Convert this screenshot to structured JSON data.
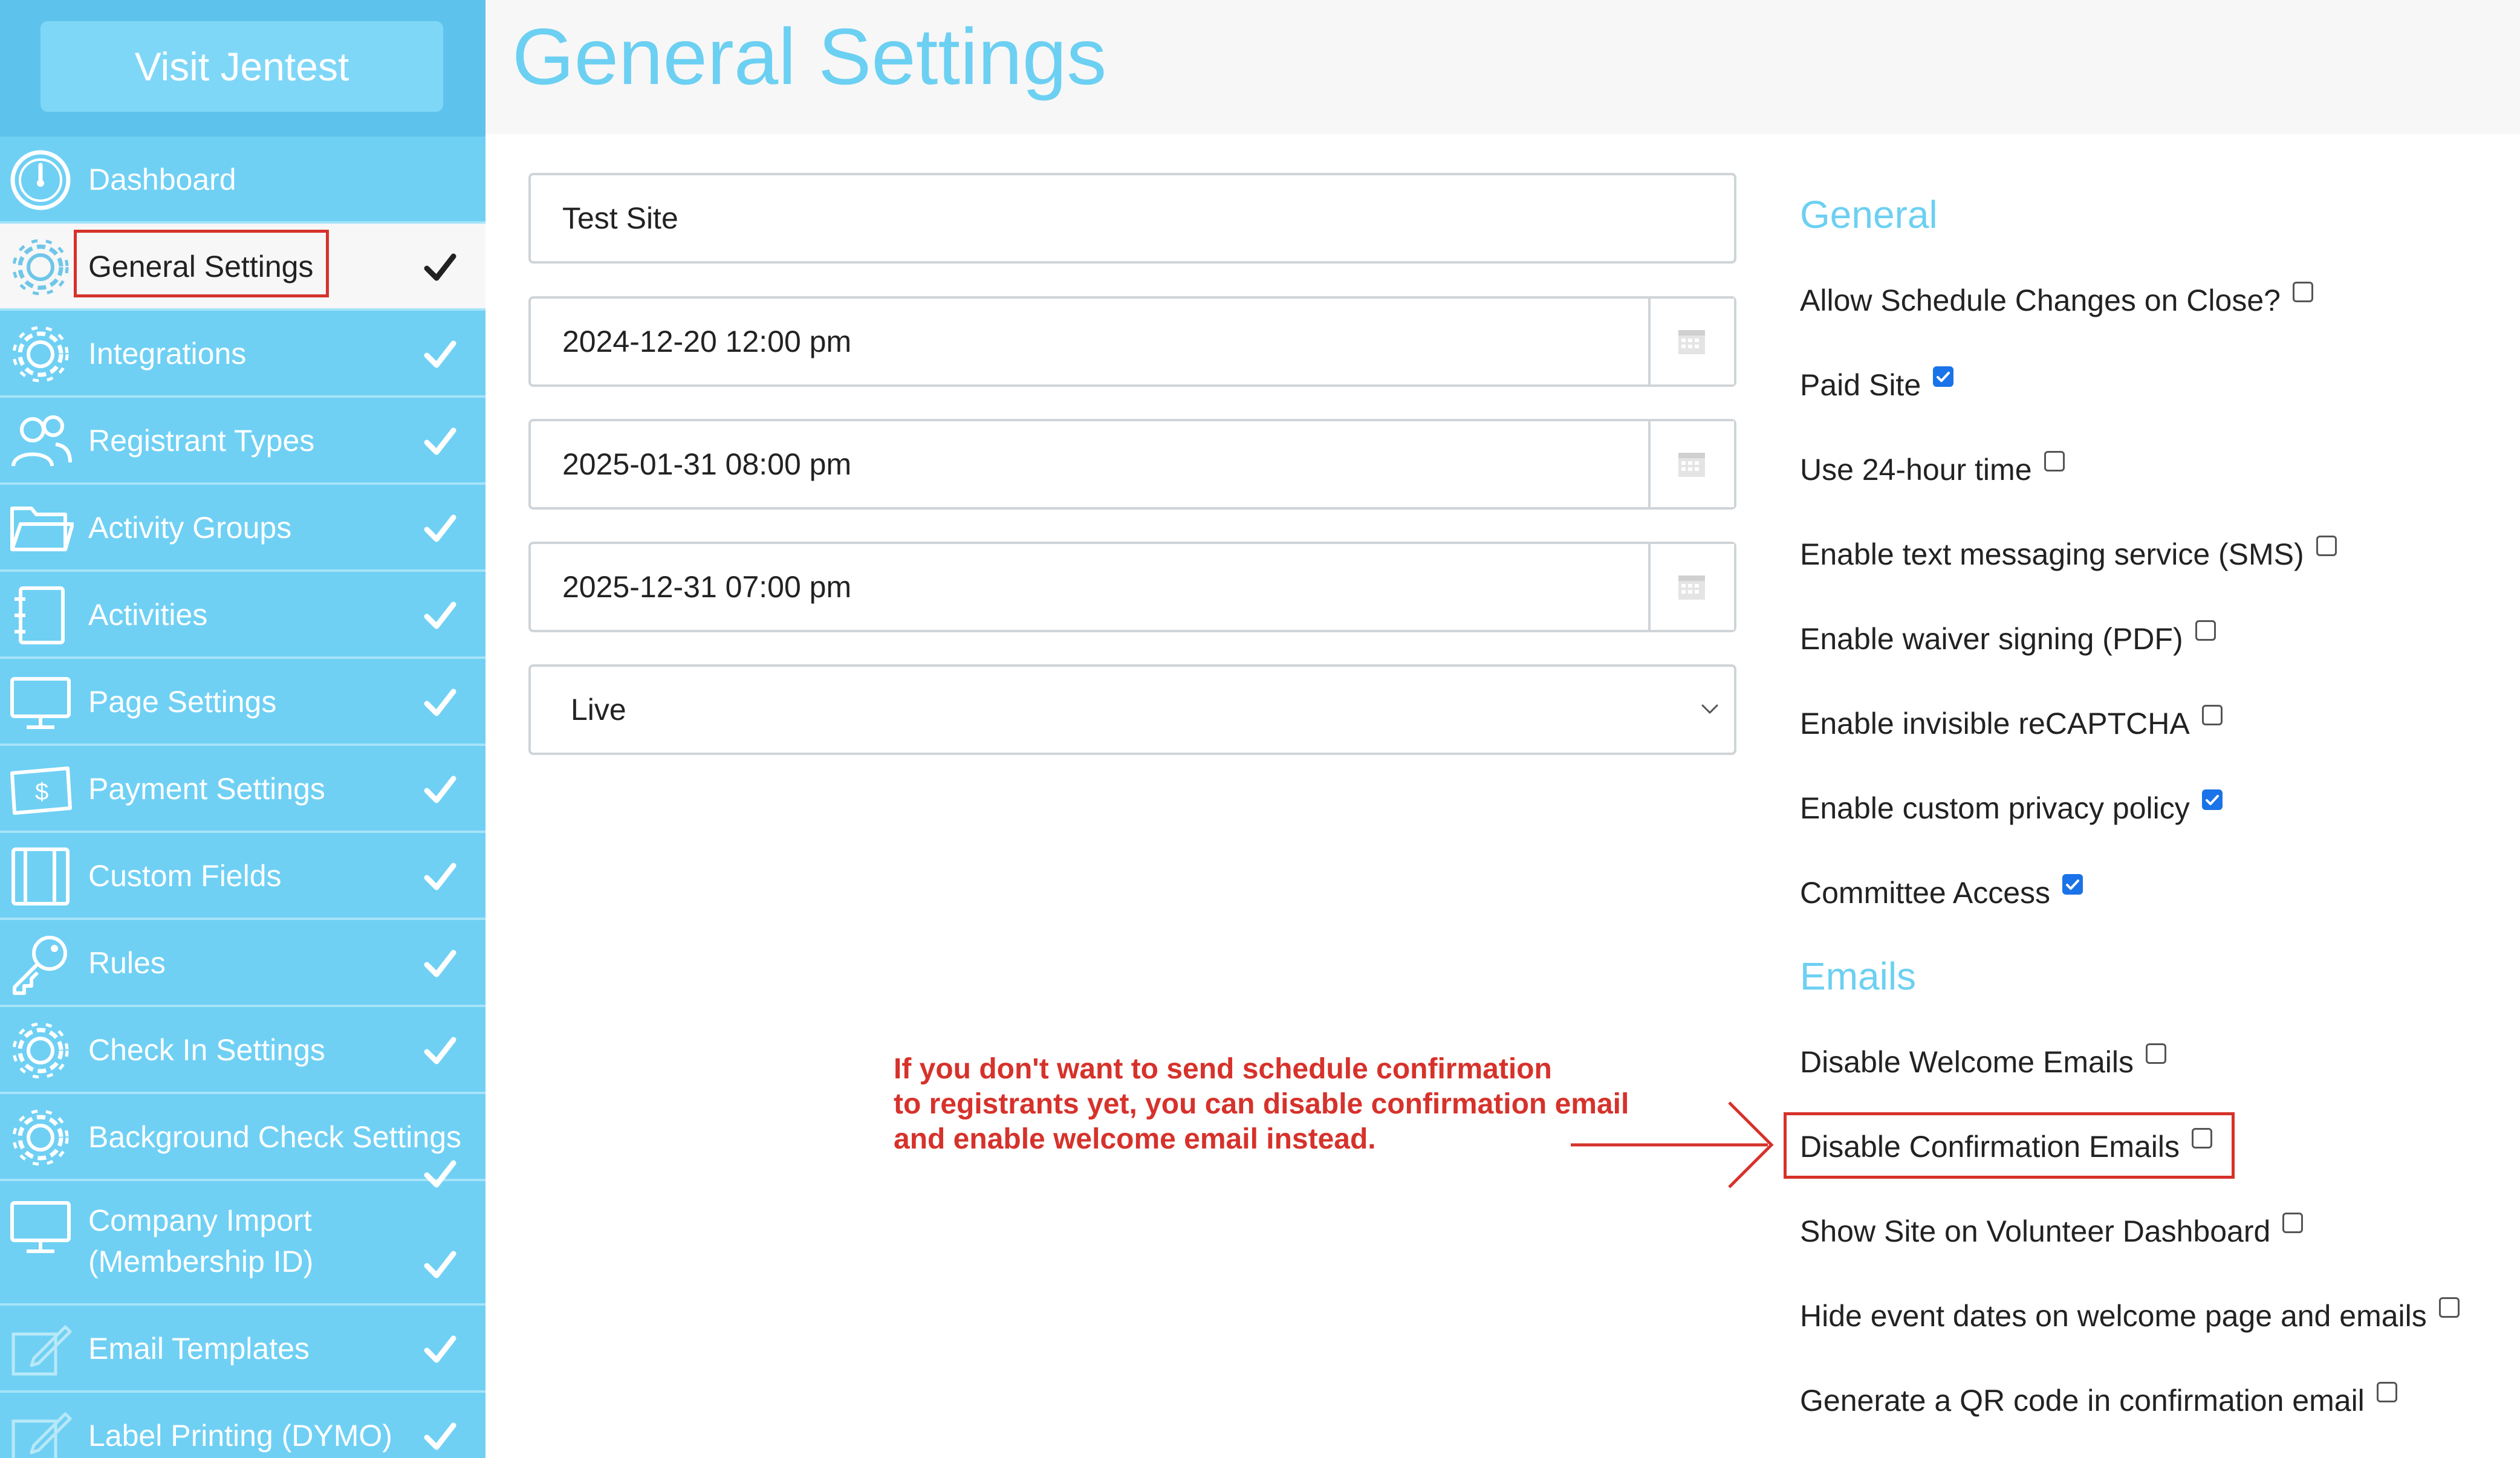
{
  "sidebar": {
    "visit_button": "Visit Jentest",
    "items": [
      {
        "label": "Dashboard",
        "icon": "dashboard-icon",
        "checked": false,
        "active": false
      },
      {
        "label": "General Settings",
        "icon": "gear-icon",
        "checked": true,
        "active": true
      },
      {
        "label": "Integrations",
        "icon": "gear-icon",
        "checked": true,
        "active": false
      },
      {
        "label": "Registrant Types",
        "icon": "users-icon",
        "checked": true,
        "active": false
      },
      {
        "label": "Activity Groups",
        "icon": "folder-icon",
        "checked": true,
        "active": false
      },
      {
        "label": "Activities",
        "icon": "notebook-icon",
        "checked": true,
        "active": false
      },
      {
        "label": "Page Settings",
        "icon": "monitor-icon",
        "checked": true,
        "active": false
      },
      {
        "label": "Payment Settings",
        "icon": "money-icon",
        "checked": true,
        "active": false
      },
      {
        "label": "Custom Fields",
        "icon": "notebook-icon",
        "checked": true,
        "active": false
      },
      {
        "label": "Rules",
        "icon": "key-icon",
        "checked": true,
        "active": false
      },
      {
        "label": "Check In Settings",
        "icon": "gear-icon",
        "checked": true,
        "active": false
      },
      {
        "label": "Background Check Settings",
        "icon": "gear-icon",
        "checked": true,
        "active": false
      },
      {
        "label_line1": "Company Import",
        "label_line2": "(Membership ID)",
        "icon": "monitor-icon",
        "checked": true,
        "active": false
      },
      {
        "label": "Email Templates",
        "icon": "pencil-icon",
        "checked": true,
        "active": false
      },
      {
        "label": "Label Printing (DYMO)",
        "icon": "pencil-icon",
        "checked": true,
        "active": false
      }
    ]
  },
  "header": {
    "title": "General Settings"
  },
  "form": {
    "site_name": "Test Site",
    "date1": "2024-12-20 12:00 pm",
    "date2": "2025-01-31 08:00 pm",
    "date3": "2025-12-31 07:00 pm",
    "status": "Live"
  },
  "general": {
    "heading": "General",
    "options": [
      {
        "label": "Allow Schedule Changes on Close?",
        "checked": false
      },
      {
        "label": "Paid Site",
        "checked": true
      },
      {
        "label": "Use 24-hour time",
        "checked": false
      },
      {
        "label": "Enable text messaging service (SMS)",
        "checked": false
      },
      {
        "label": "Enable waiver signing (PDF)",
        "checked": false
      },
      {
        "label": "Enable invisible reCAPTCHA",
        "checked": false
      },
      {
        "label": "Enable custom privacy policy",
        "checked": true
      },
      {
        "label": "Committee Access",
        "checked": true
      }
    ]
  },
  "emails": {
    "heading": "Emails",
    "options": [
      {
        "label": "Disable Welcome Emails",
        "checked": false
      },
      {
        "label": "Disable Confirmation Emails",
        "checked": false
      },
      {
        "label": "Show Site on Volunteer Dashboard",
        "checked": false
      },
      {
        "label": "Hide event dates on welcome page and emails",
        "checked": false
      },
      {
        "label": "Generate a QR code in confirmation email",
        "checked": false
      }
    ]
  },
  "annotation": {
    "line1": "If you don't want to send schedule confirmation",
    "line2": "to registrants yet, you can disable confirmation email",
    "line3": "and enable welcome email instead.",
    "color": "#d6322b"
  },
  "colors": {
    "sidebar": "#6fd0f4",
    "accent": "#6cd0f2",
    "checkbox": "#1a73e8"
  }
}
